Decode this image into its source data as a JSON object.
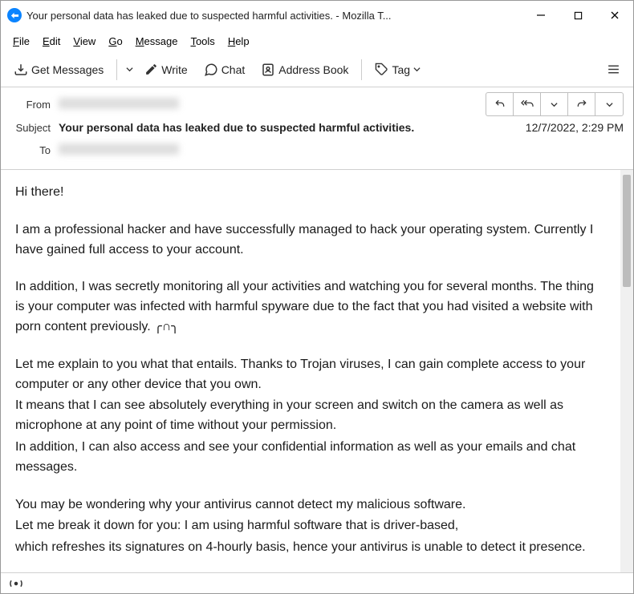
{
  "window": {
    "title": "Your personal data has leaked due to suspected harmful activities. - Mozilla T..."
  },
  "menubar": [
    "File",
    "Edit",
    "View",
    "Go",
    "Message",
    "Tools",
    "Help"
  ],
  "toolbar": {
    "get_messages": "Get Messages",
    "write": "Write",
    "chat": "Chat",
    "address_book": "Address Book",
    "tag": "Tag"
  },
  "headers": {
    "from_label": "From",
    "subject_label": "Subject",
    "to_label": "To",
    "subject_value": "Your personal data has leaked due to suspected harmful activities.",
    "date": "12/7/2022, 2:29 PM"
  },
  "body": {
    "p1": "Hi there!",
    "p2": "I am a professional hacker and have successfully managed to hack your operating system. Currently I have gained full access to your account.",
    "p3": "In addition, I was secretly monitoring all your activities and watching you for several months. The thing is your computer was infected with harmful spyware due to the fact that you had visited a website with porn content previously. ╭∩╮",
    "p4": "Let me explain to you what that entails. Thanks to Trojan viruses, I can gain complete access to your computer or any other device that you own.",
    "p5": "It means that I can see absolutely everything in your screen and switch on the camera as well as microphone at any point of time without your permission.",
    "p6": "In addition, I can also access and see your confidential information as well as your emails and chat messages.",
    "p7": "You may be wondering why your antivirus cannot detect my malicious software.",
    "p8": "Let me break it down for you: I am using harmful software that is driver-based,",
    "p9": "which refreshes its signatures on 4-hourly basis, hence your antivirus is unable to detect it presence."
  },
  "status": {
    "signal_icon": "(o)"
  }
}
